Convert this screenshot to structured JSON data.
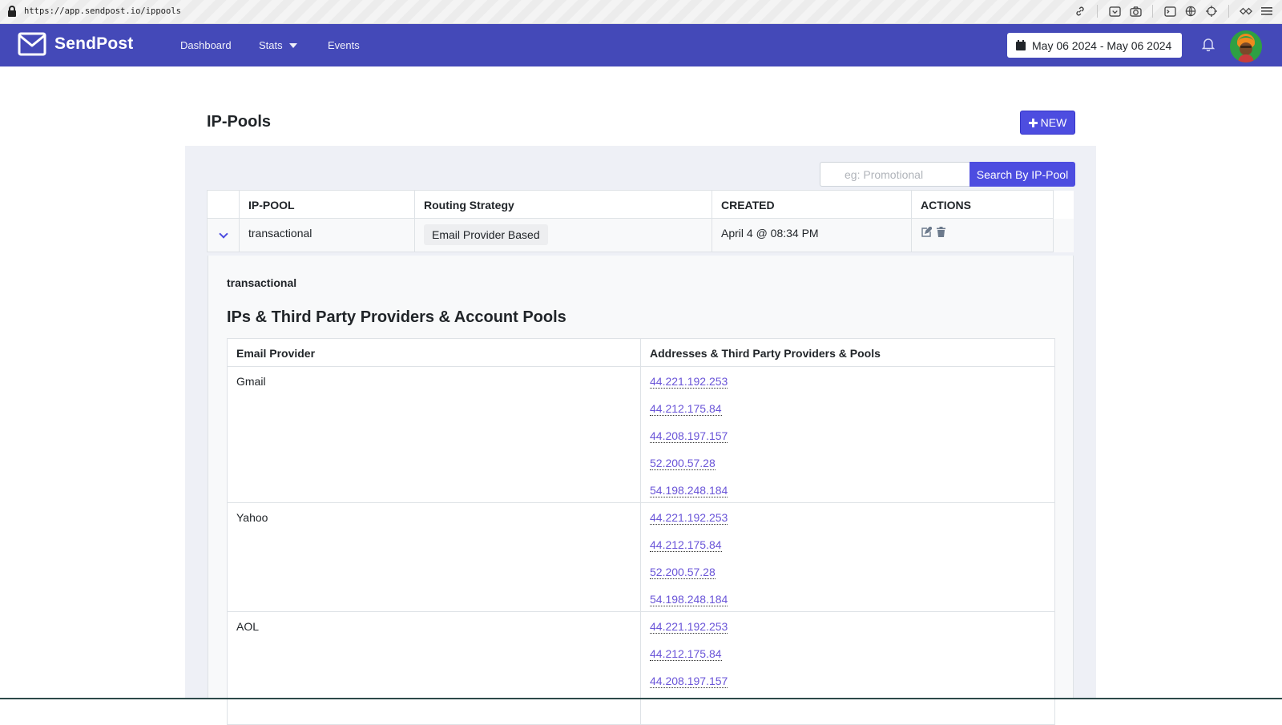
{
  "browser": {
    "url": "https://app.sendpost.io/ippools"
  },
  "navbar": {
    "brand": "SendPost",
    "links": {
      "dashboard": "Dashboard",
      "stats": "Stats",
      "events": "Events"
    },
    "date_range": "May 06 2024 - May 06 2024"
  },
  "page": {
    "title": "IP-Pools",
    "new_button": "NEW",
    "search": {
      "placeholder": "eg: Promotional",
      "button": "Search By IP-Pool"
    }
  },
  "table": {
    "headers": {
      "pool": "IP-POOL",
      "routing": "Routing Strategy",
      "created": "CREATED",
      "actions": "ACTIONS"
    },
    "rows": [
      {
        "pool": "transactional",
        "routing": "Email Provider Based",
        "created": "April 4 @ 08:34 PM"
      }
    ]
  },
  "detail": {
    "pool_name": "transactional",
    "section_title": "IPs & Third Party Providers & Account Pools",
    "headers": {
      "provider": "Email Provider",
      "addresses": "Addresses & Third Party Providers & Pools"
    },
    "providers": [
      {
        "name": "Gmail",
        "ips": [
          "44.221.192.253",
          "44.212.175.84",
          "44.208.197.157",
          "52.200.57.28",
          "54.198.248.184"
        ]
      },
      {
        "name": "Yahoo",
        "ips": [
          "44.221.192.253",
          "44.212.175.84",
          "52.200.57.28",
          "54.198.248.184"
        ]
      },
      {
        "name": "AOL",
        "ips": [
          "44.221.192.253",
          "44.212.175.84",
          "44.208.197.157"
        ]
      }
    ]
  },
  "colors": {
    "navbar": "#4449b8",
    "primary_button": "#4d4de0",
    "link": "#6a55d8",
    "card_bg": "#eef0f6"
  }
}
